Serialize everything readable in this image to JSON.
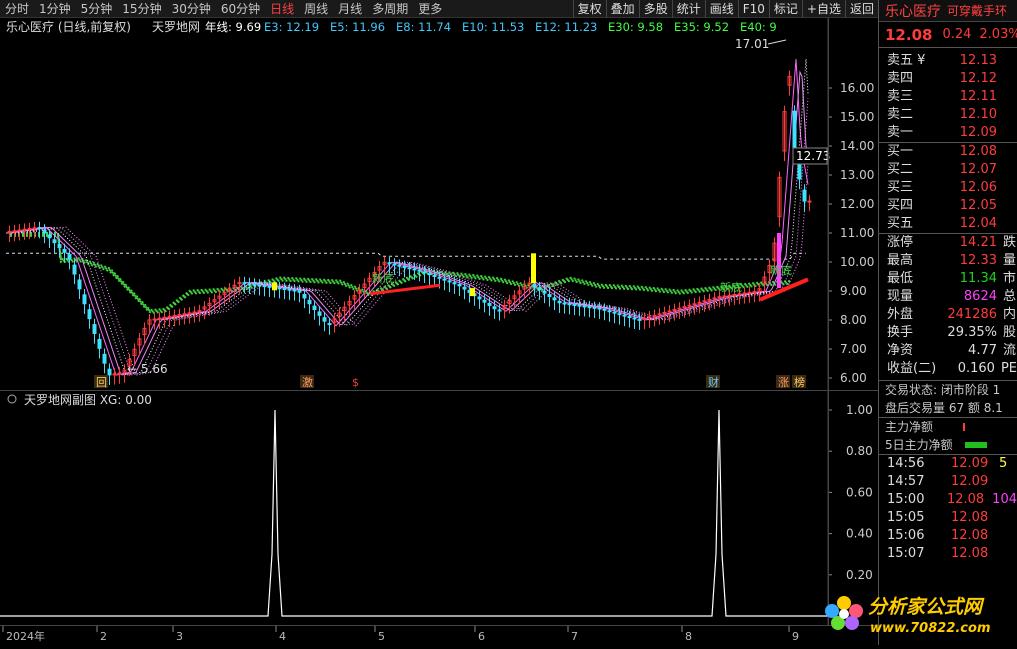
{
  "toolbar": {
    "timeframes": [
      "分时",
      "1分钟",
      "5分钟",
      "15分钟",
      "30分钟",
      "60分钟",
      "日线",
      "周线",
      "月线",
      "多周期",
      "更多"
    ],
    "active_index": 6,
    "right_buttons": [
      "复权",
      "叠加",
      "多股",
      "统计",
      "画线",
      "F10",
      "标记",
      "+自选",
      "返回"
    ]
  },
  "main": {
    "stock_label": "乐心医疗 (日线,前复权)",
    "indicator_name": "天罗地网",
    "indicators": [
      {
        "label": "年线: 9.69",
        "color": "#ffffff"
      },
      {
        "label": "E3: 12.19",
        "color": "#40c8ff"
      },
      {
        "label": "E5: 11.96",
        "color": "#40c8ff"
      },
      {
        "label": "E8: 11.74",
        "color": "#40c8ff"
      },
      {
        "label": "E10: 11.53",
        "color": "#40c8ff"
      },
      {
        "label": "E12: 11.23",
        "color": "#40c8ff"
      },
      {
        "label": "E30: 9.58",
        "color": "#40ff40"
      },
      {
        "label": "E35: 9.52",
        "color": "#40ff40"
      },
      {
        "label": "E40: 9",
        "color": "#40ff40"
      }
    ],
    "y_ticks": [
      "16.00",
      "15.00",
      "14.00",
      "13.00",
      "12.00",
      "11.00",
      "10.00",
      "9.00",
      "8.00",
      "7.00",
      "6.00"
    ],
    "high_label": "17.01",
    "low_label": "5.66",
    "last_label": "12.73",
    "bottom_badge": "新底",
    "event_markers": [
      "回",
      "激",
      "$",
      "财",
      "涨",
      "榜"
    ]
  },
  "sub": {
    "title": "天罗地网副图",
    "value_label": "XG: 0.00",
    "y_ticks": [
      "1.00",
      "0.80",
      "0.60",
      "0.40",
      "0.20"
    ]
  },
  "time_axis": [
    "2024年",
    "2",
    "3",
    "4",
    "5",
    "6",
    "7",
    "8",
    "9"
  ],
  "quote": {
    "name": "乐心医疗",
    "ticker_note": "可穿戴手环",
    "price": "12.08",
    "change": "0.24",
    "pct": "2.03%",
    "asks": [
      {
        "label": "卖五 ¥",
        "price": "12.13"
      },
      {
        "label": "卖四",
        "price": "12.12"
      },
      {
        "label": "卖三",
        "price": "12.11"
      },
      {
        "label": "卖二",
        "price": "12.10"
      },
      {
        "label": "卖一",
        "price": "12.09"
      }
    ],
    "bids": [
      {
        "label": "买一",
        "price": "12.08"
      },
      {
        "label": "买二",
        "price": "12.07"
      },
      {
        "label": "买三",
        "price": "12.06"
      },
      {
        "label": "买四",
        "price": "12.05"
      },
      {
        "label": "买五",
        "price": "12.04"
      }
    ],
    "stats": [
      {
        "label": "涨停",
        "value": "14.21",
        "color": "#ff3c3c",
        "extra": "跌"
      },
      {
        "label": "最高",
        "value": "12.33",
        "color": "#ff3c3c",
        "extra": "量"
      },
      {
        "label": "最低",
        "value": "11.34",
        "color": "#20d020",
        "extra": "市"
      },
      {
        "label": "现量",
        "value": "8624",
        "color": "#ff40ff",
        "extra": "总"
      },
      {
        "label": "外盘",
        "value": "241286",
        "color": "#ff3c3c",
        "extra": "内"
      },
      {
        "label": "换手",
        "value": "29.35%",
        "color": "#ddd",
        "extra": "股"
      },
      {
        "label": "净资",
        "value": "4.77",
        "color": "#ddd",
        "extra": "流"
      },
      {
        "label": "收益(二)",
        "value": "0.160",
        "color": "#ddd",
        "extra": "PE"
      }
    ],
    "trade_status": "交易状态: 闭市阶段 1",
    "after_hours": "盘后交易量 67 额 8.1",
    "main_flow": "主力净额",
    "five_day_flow": "5日主力净额",
    "ticks": [
      {
        "time": "14:56",
        "price": "12.09",
        "vol": "5"
      },
      {
        "time": "14:57",
        "price": "12.09",
        "vol": ""
      },
      {
        "time": "15:00",
        "price": "12.08",
        "vol": "104"
      },
      {
        "time": "15:05",
        "price": "12.08",
        "vol": ""
      },
      {
        "time": "15:06",
        "price": "12.08",
        "vol": ""
      },
      {
        "time": "15:07",
        "price": "12.08",
        "vol": ""
      }
    ],
    "watermark": "分析家公式网",
    "watermark_url": "www.70822.com"
  },
  "colors": {
    "up": "#ff3c3c",
    "down": "#40e0ff",
    "bg": "#000000",
    "accent": "#ffff00"
  }
}
